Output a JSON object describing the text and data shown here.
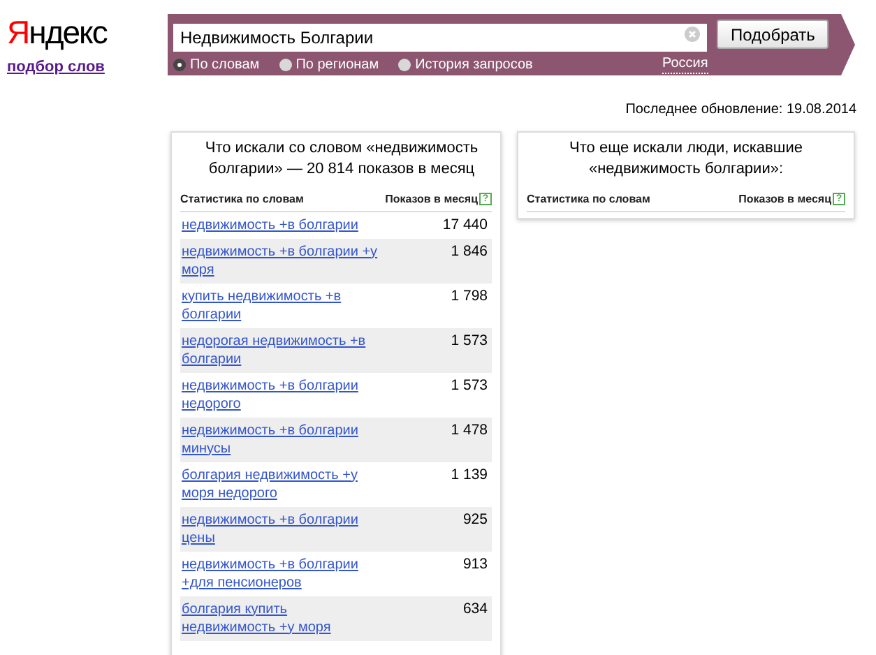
{
  "logo": "Яндекс",
  "service_link": "подбор слов",
  "search": {
    "value": "Недвижимость Болгарии",
    "button": "Подобрать"
  },
  "modes": [
    {
      "label": "По словам",
      "selected": true
    },
    {
      "label": "По регионам",
      "selected": false
    },
    {
      "label": "История запросов",
      "selected": false
    }
  ],
  "region_link": "Россия",
  "last_update": "Последнее обновление: 19.08.2014",
  "left_panel": {
    "title": "Что искали со словом «недвижимость болгарии» — 20 814 показов в месяц",
    "columns": [
      "Статистика по словам",
      "Показов в месяц"
    ],
    "help": "?",
    "rows": [
      {
        "phrase": "недвижимость +в болгарии",
        "count": "17 440"
      },
      {
        "phrase": "недвижимость +в болгарии +у моря",
        "count": "1 846"
      },
      {
        "phrase": "купить недвижимость +в болгарии",
        "count": "1 798"
      },
      {
        "phrase": "недорогая недвижимость +в болгарии",
        "count": "1 573"
      },
      {
        "phrase": "недвижимость +в болгарии недорого",
        "count": "1 573"
      },
      {
        "phrase": "недвижимость +в болгарии минусы",
        "count": "1 478"
      },
      {
        "phrase": "болгария недвижимость +у моря недорого",
        "count": "1 139"
      },
      {
        "phrase": "недвижимость +в болгарии цены",
        "count": "925"
      },
      {
        "phrase": "недвижимость +в болгарии +для пенсионеров",
        "count": "913"
      },
      {
        "phrase": "болгария купить недвижимость +у моря",
        "count": "634"
      }
    ]
  },
  "right_panel": {
    "title": "Что еще искали люди, искавшие «недвижимость болгарии»:",
    "columns": [
      "Статистика по словам",
      "Показов в месяц"
    ],
    "help": "?"
  }
}
